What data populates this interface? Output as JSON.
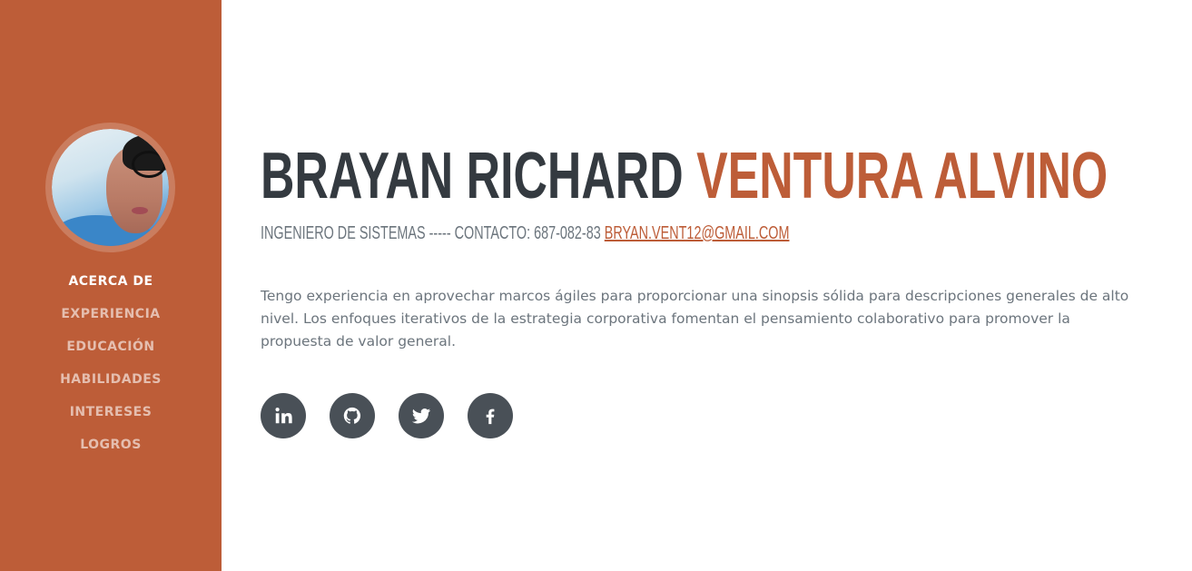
{
  "sidebar": {
    "avatar_alt": "profile photo",
    "nav": [
      {
        "label": "ACERCA DE",
        "active": true
      },
      {
        "label": "EXPERIENCIA",
        "active": false
      },
      {
        "label": "EDUCACIÓN",
        "active": false
      },
      {
        "label": "HABILIDADES",
        "active": false
      },
      {
        "label": "INTERESES",
        "active": false
      },
      {
        "label": "LOGROS",
        "active": false
      }
    ]
  },
  "header": {
    "first_name": "BRAYAN RICHARD",
    "last_name": "VENTURA ALVINO",
    "subheading": "INGENIERO DE SISTEMAS ----- CONTACTO: 687-082-83",
    "email": "BRYAN.VENT12@GMAIL.COM"
  },
  "about": {
    "text": "Tengo experiencia en aprovechar marcos ágiles para proporcionar una sinopsis sólida para descripciones generales de alto nivel. Los enfoques iterativos de la estrategia corporativa fomentan el pensamiento colaborativo para promover la propuesta de valor general."
  },
  "socials": [
    {
      "icon": "linkedin-icon"
    },
    {
      "icon": "github-icon"
    },
    {
      "icon": "twitter-icon"
    },
    {
      "icon": "facebook-icon"
    }
  ],
  "colors": {
    "accent": "#bd5d38",
    "dark": "#343a40",
    "muted": "#6c757d",
    "social_bg": "#495057"
  }
}
